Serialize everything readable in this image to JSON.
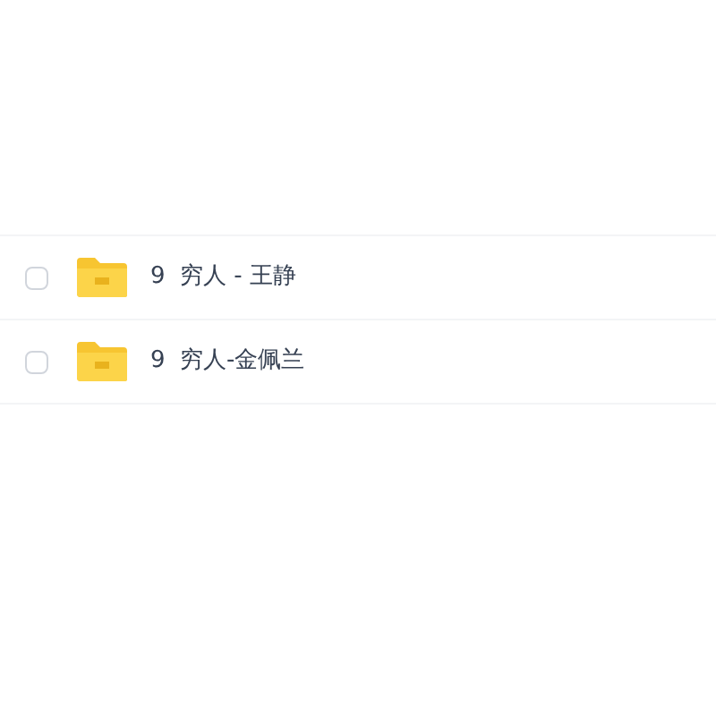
{
  "files": [
    {
      "name": "9  穷人 - 王静",
      "checked": false
    },
    {
      "name": "9  穷人-金佩兰",
      "checked": false
    }
  ]
}
